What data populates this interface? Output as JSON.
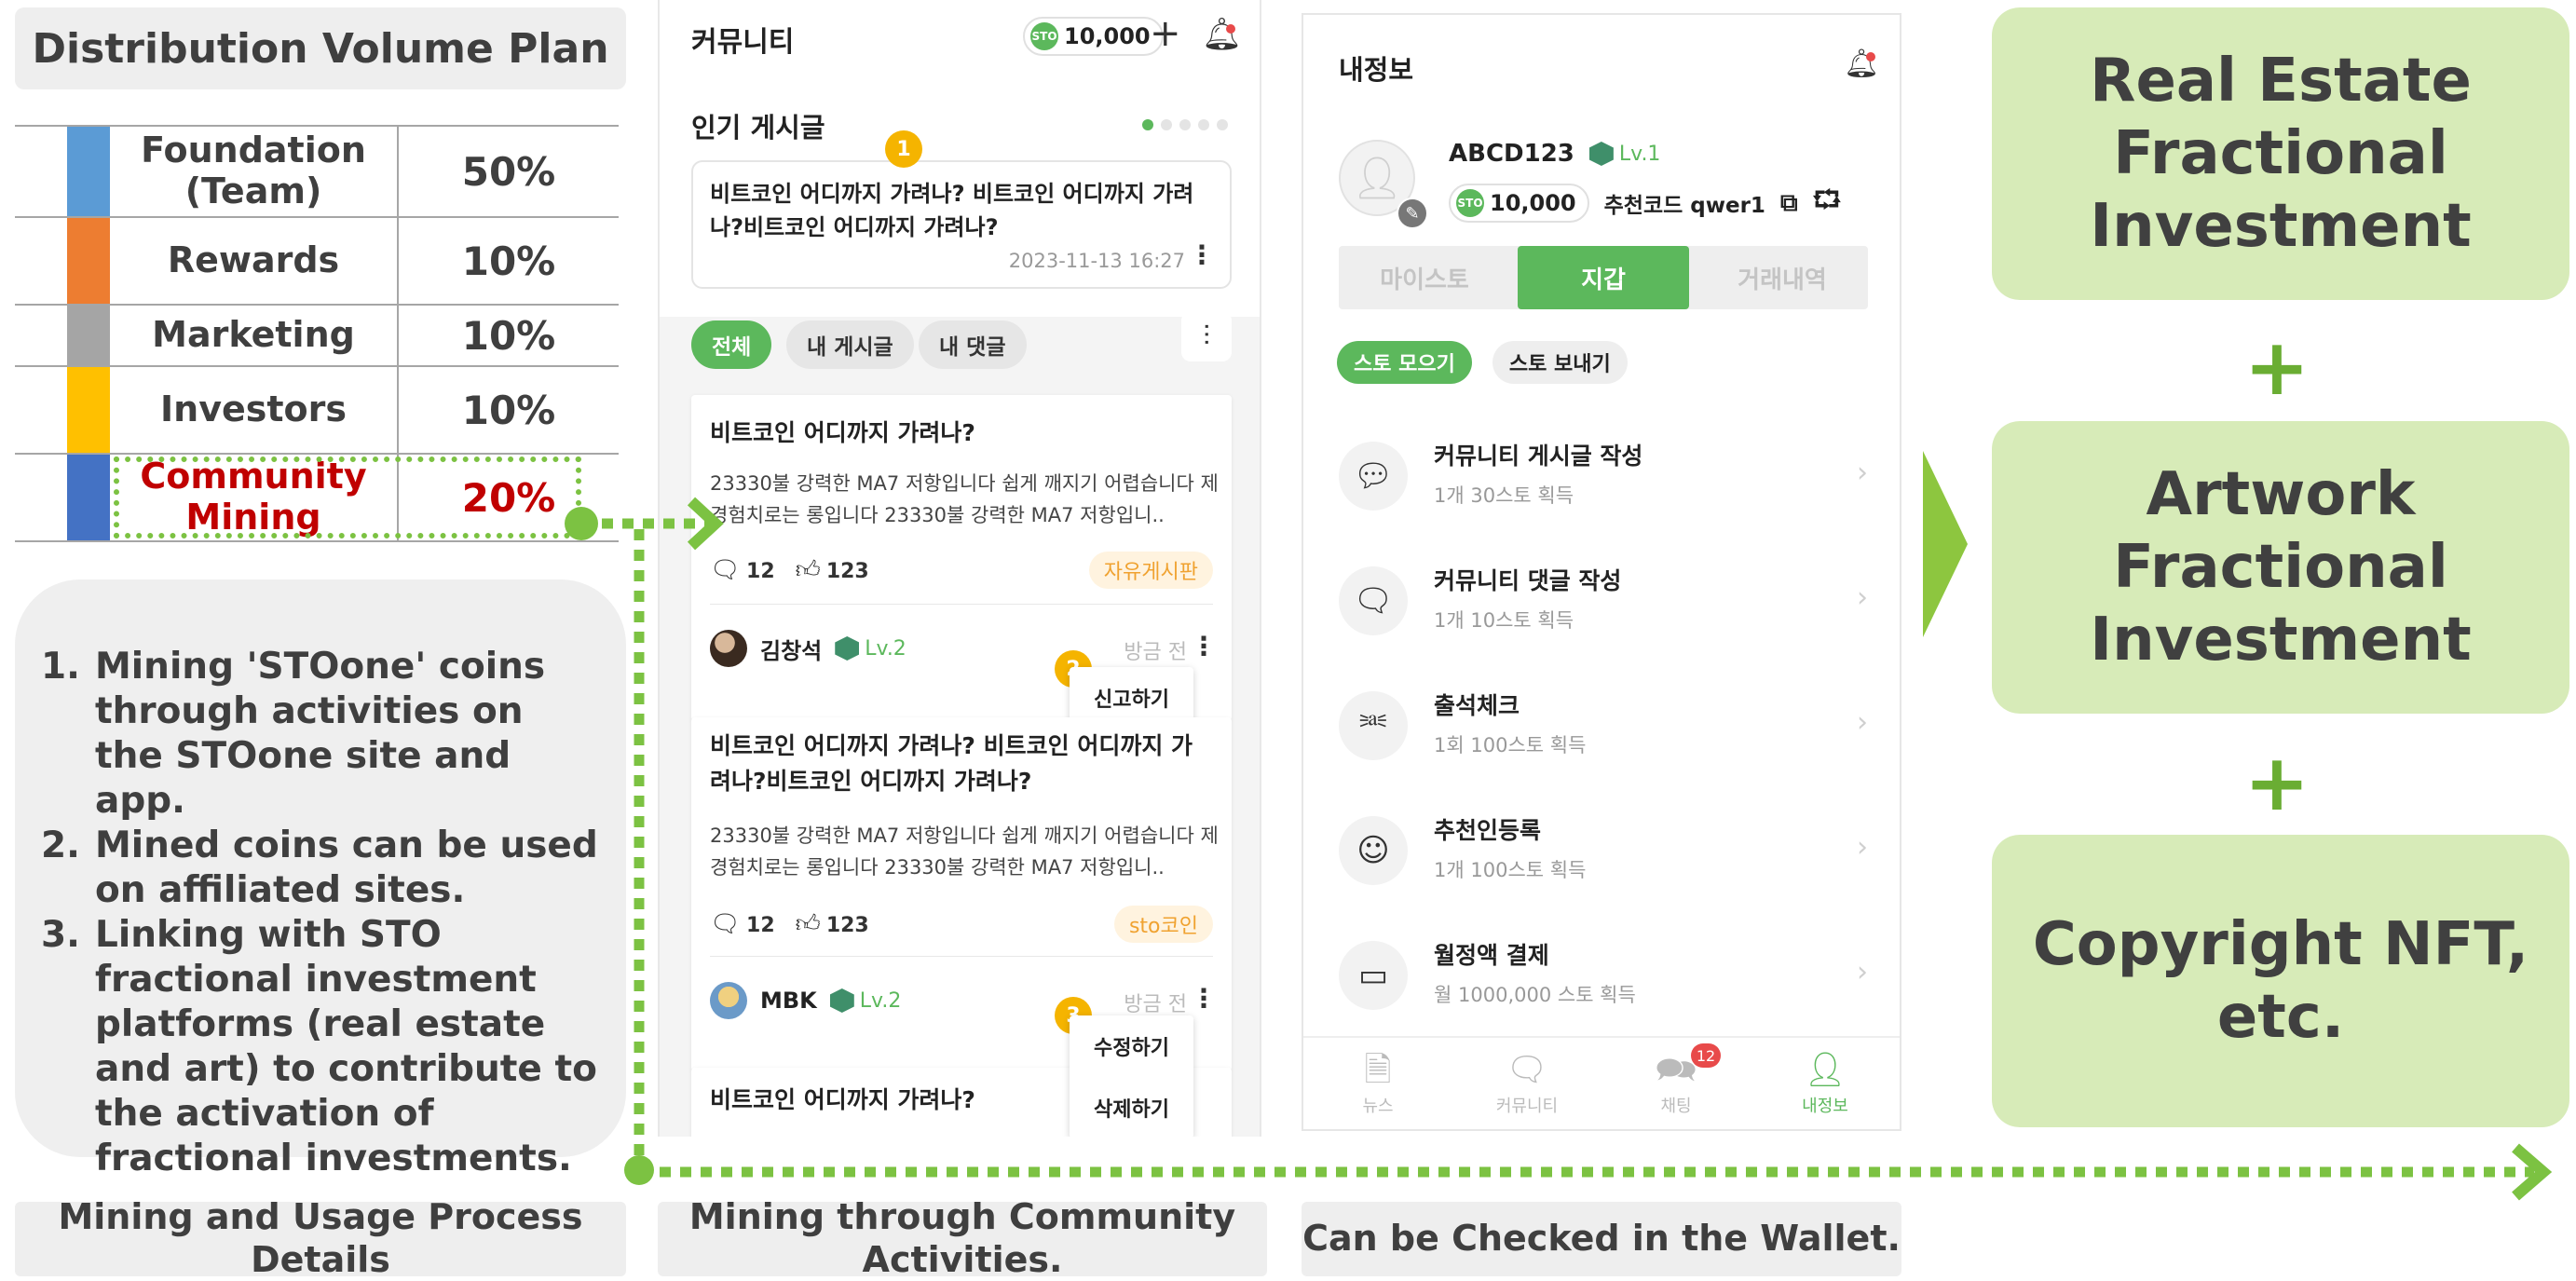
{
  "left": {
    "title": "Distribution Volume Plan",
    "distribution": [
      {
        "name": "Foundation (Team)",
        "percent": "50%",
        "color": "#5b9bd5"
      },
      {
        "name": "Rewards",
        "percent": "10%",
        "color": "#ed7d31"
      },
      {
        "name": "Marketing",
        "percent": "10%",
        "color": "#a5a5a5"
      },
      {
        "name": "Investors",
        "percent": "10%",
        "color": "#ffc000"
      },
      {
        "name": "Community Mining",
        "percent": "20%",
        "color": "#4472c4"
      }
    ],
    "highlight_color": "#c00000",
    "process": [
      {
        "num": "1.",
        "text": "Mining 'STOone' coins through activities on the STOone site and app."
      },
      {
        "num": "2.",
        "text": "Mined coins can be used on affiliated sites."
      },
      {
        "num": "3.",
        "text": "Linking with STO fractional investment platforms (real estate and art) to contribute to the activation of fractional investments."
      }
    ],
    "caption": "Mining and Usage Process Details"
  },
  "community": {
    "title": "커뮤니티",
    "coin_label": "STO",
    "coin_balance": "10,000",
    "popular_title": "인기 게시글",
    "popular_post": "비트코인 어디까지 가려나? 비트코인 어디까지 가려나?비트코인 어디까지 가려나?",
    "popular_date": "2023-11-13 16:27",
    "filters": [
      "전체",
      "내 게시글",
      "내 댓글"
    ],
    "posts": [
      {
        "title": "비트코인 어디까지 가려나?",
        "body": "23330불 강력한 MA7 저항입니다 쉽게 깨지기 어렵습니다 제 경험치로는 롱입니다 23330불 강력한 MA7 저항입니..",
        "comments": "12",
        "likes": "123",
        "tag": "자유게시판",
        "author": "김창석",
        "level": "Lv.2",
        "time": "방금 전",
        "menu": [
          "신고하기"
        ]
      },
      {
        "title": "비트코인 어디까지 가려나? 비트코인 어디까지 가려나?비트코인 어디까지 가려나?",
        "body": "23330불 강력한 MA7 저항입니다 쉽게 깨지기 어렵습니다 제 경험치로는 롱입니다 23330불 강력한 MA7 저항입니..",
        "comments": "12",
        "likes": "123",
        "tag": "sto코인",
        "author": "MBK",
        "level": "Lv.2",
        "time": "방금 전",
        "menu": [
          "수정하기",
          "삭제하기"
        ]
      },
      {
        "title": "비트코인 어디까지 가려나?"
      }
    ],
    "badges": [
      "1",
      "2",
      "3"
    ],
    "caption": "Mining through Community Activities."
  },
  "wallet": {
    "title": "내정보",
    "username": "ABCD123",
    "level": "Lv.1",
    "coin_label": "STO",
    "balance": "10,000",
    "referral": "추천코드 qwer1",
    "tabs": [
      "마이스토",
      "지갑",
      "거래내역"
    ],
    "subtabs": [
      "스토 모으기",
      "스토 보내기"
    ],
    "tasks": [
      {
        "name": "커뮤니티 게시글 작성",
        "reward": "1개 30스토 획득"
      },
      {
        "name": "커뮤니티 댓글 작성",
        "reward": "1개 10스토 획득"
      },
      {
        "name": "출석체크",
        "reward": "1회 100스토 획득"
      },
      {
        "name": "추천인등록",
        "reward": "1개 100스토 획득"
      },
      {
        "name": "월정액 결제",
        "reward": "월 1000,000 스토 획득"
      }
    ],
    "nav": [
      {
        "label": "뉴스"
      },
      {
        "label": "커뮤니티"
      },
      {
        "label": "채팅",
        "badge": "12"
      },
      {
        "label": "내정보"
      }
    ],
    "caption": "Can be Checked in the Wallet."
  },
  "right": {
    "boxes": [
      "Real Estate Fractional Investment",
      "Artwork Fractional Investment",
      "Copyright NFT, etc."
    ],
    "plus": "+"
  },
  "colors": {
    "accent_green": "#5cb85c",
    "box_green": "#d7ebb8",
    "dotted_line": "#7cc242"
  }
}
